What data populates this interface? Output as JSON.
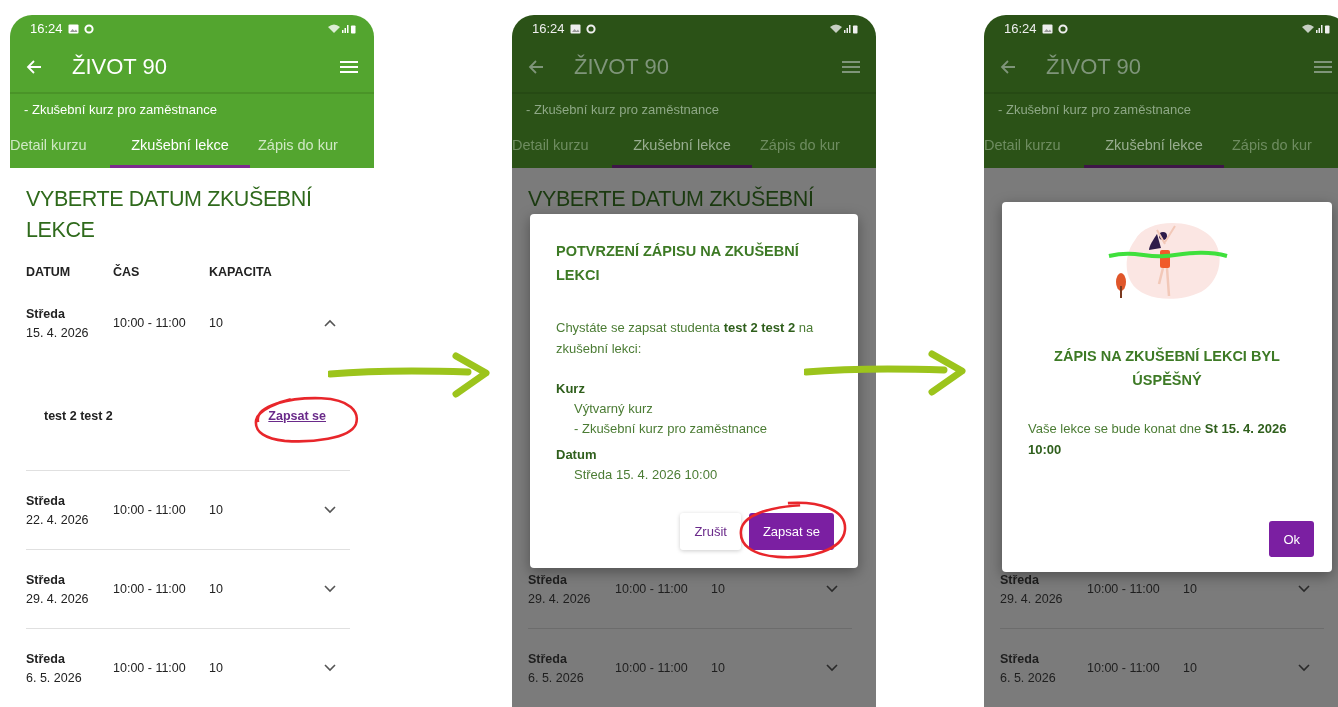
{
  "panels": [
    {
      "dimmed": false,
      "status_time": "16:24",
      "title": "ŽIVOT 90",
      "subtitle": "- Zkušební kurz pro zaměstnance",
      "tabs": [
        {
          "label": "Detail kurzu",
          "selected": false
        },
        {
          "label": "Zkušební lekce",
          "selected": true
        },
        {
          "label": "Zápis do kur",
          "selected": false
        }
      ],
      "heading": "VYBERTE DATUM ZKUŠEBNÍ LEKCE",
      "columns": [
        "DATUM",
        "ČAS",
        "KAPACITA"
      ],
      "rows": [
        {
          "day": "Středa",
          "date": "15. 4. 2026",
          "time": "10:00 - 11:00",
          "capacity": "10",
          "expanded": true,
          "student": "test 2 test 2",
          "action": "Zapsat se",
          "highlighted": true
        },
        {
          "day": "Středa",
          "date": "22. 4. 2026",
          "time": "10:00 - 11:00",
          "capacity": "10",
          "expanded": false
        },
        {
          "day": "Středa",
          "date": "29. 4. 2026",
          "time": "10:00 - 11:00",
          "capacity": "10",
          "expanded": false
        },
        {
          "day": "Středa",
          "date": "6. 5. 2026",
          "time": "10:00 - 11:00",
          "capacity": "10",
          "expanded": false
        }
      ]
    },
    {
      "dimmed": true,
      "status_time": "16:24",
      "title": "ŽIVOT 90",
      "subtitle": "- Zkušební kurz pro zaměstnance",
      "tabs": [
        {
          "label": "Detail kurzu",
          "selected": false
        },
        {
          "label": "Zkušební lekce",
          "selected": true
        },
        {
          "label": "Zápis do kur",
          "selected": false
        }
      ],
      "heading": "VYBERTE DATUM ZKUŠEBNÍ",
      "rows": [
        {
          "day": "Středa",
          "date": "29. 4. 2026",
          "time": "10:00 - 11:00",
          "capacity": "10",
          "expanded": false
        },
        {
          "day": "Středa",
          "date": "6. 5. 2026",
          "time": "10:00 - 11:00",
          "capacity": "10",
          "expanded": false
        }
      ],
      "dialog": {
        "kind": "confirm",
        "title": "POTVRZENÍ ZÁPISU NA ZKUŠEBNÍ LEKCI",
        "message": "Chystáte se zapsat studenta **test 2 test 2** na zkušební lekci:",
        "fields": [
          {
            "label": "Kurz",
            "lines": [
              "Výtvarný kurz",
              "- Zkušební kurz pro zaměstnance"
            ]
          },
          {
            "label": "Datum",
            "lines": [
              "Středa 15. 4. 2026 10:00"
            ]
          }
        ],
        "buttons": [
          {
            "label": "Zrušit",
            "kind": "text",
            "highlighted": false
          },
          {
            "label": "Zapsat se",
            "kind": "primary",
            "highlighted": true
          }
        ]
      }
    },
    {
      "dimmed": true,
      "status_time": "16:24",
      "title": "ŽIVOT 90",
      "subtitle": "- Zkušební kurz pro zaměstnance",
      "tabs": [
        {
          "label": "Detail kurzu",
          "selected": false
        },
        {
          "label": "Zkušební lekce",
          "selected": true
        },
        {
          "label": "Zápis do kur",
          "selected": false
        }
      ],
      "rows": [
        {
          "day": "Středa",
          "date": "29. 4. 2026",
          "time": "10:00 - 11:00",
          "capacity": "10",
          "expanded": false
        },
        {
          "day": "Středa",
          "date": "6. 5. 2026",
          "time": "10:00 - 11:00",
          "capacity": "10",
          "expanded": false
        }
      ],
      "dialog": {
        "kind": "success",
        "title": "ZÁPIS NA ZKUŠEBNÍ LEKCI BYL ÚSPĚŠNÝ",
        "message": "Vaše lekce se bude konat dne **St 15. 4. 2026 10:00**",
        "buttons": [
          {
            "label": "Ok",
            "kind": "primary",
            "highlighted": false
          }
        ]
      }
    }
  ]
}
